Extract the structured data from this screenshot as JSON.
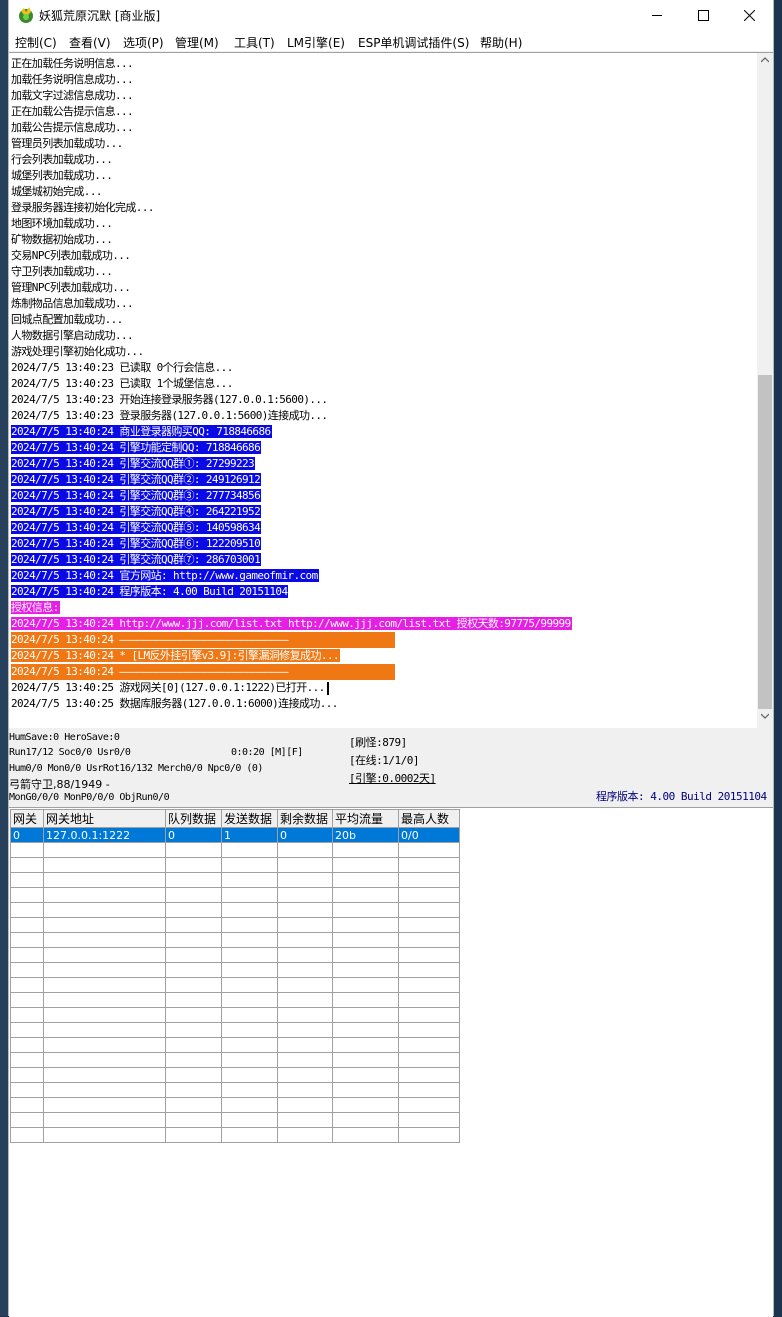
{
  "window": {
    "title": "妖狐荒原沉默 [商业版]"
  },
  "menu": [
    {
      "label": "控制(C)"
    },
    {
      "label": "查看(V)"
    },
    {
      "label": "选项(P)"
    },
    {
      "label": "管理(M)"
    },
    {
      "label": "工具(T)"
    },
    {
      "label": "LM引擎(E)"
    },
    {
      "label": "ESP单机调试插件(S)"
    },
    {
      "label": "帮助(H)"
    }
  ],
  "log": [
    {
      "text": "正在加载任务说明信息...",
      "hl": ""
    },
    {
      "text": "加载任务说明信息成功...",
      "hl": ""
    },
    {
      "text": "加载文字过滤信息成功...",
      "hl": ""
    },
    {
      "text": "正在加载公告提示信息...",
      "hl": ""
    },
    {
      "text": "加载公告提示信息成功...",
      "hl": ""
    },
    {
      "text": "管理员列表加载成功...",
      "hl": ""
    },
    {
      "text": "行会列表加载成功...",
      "hl": ""
    },
    {
      "text": "城堡列表加载成功...",
      "hl": ""
    },
    {
      "text": "城堡城初始完成...",
      "hl": ""
    },
    {
      "text": "登录服务器连接初始化完成...",
      "hl": ""
    },
    {
      "text": "地图环境加载成功...",
      "hl": ""
    },
    {
      "text": "矿物数据初始成功...",
      "hl": ""
    },
    {
      "text": "交易NPC列表加载成功...",
      "hl": ""
    },
    {
      "text": "守卫列表加载成功...",
      "hl": ""
    },
    {
      "text": "管理NPC列表加载成功...",
      "hl": ""
    },
    {
      "text": "炼制物品信息加载成功...",
      "hl": ""
    },
    {
      "text": "回城点配置加载成功...",
      "hl": ""
    },
    {
      "text": "人物数据引擎启动成功...",
      "hl": ""
    },
    {
      "text": "游戏处理引擎初始化成功...",
      "hl": ""
    },
    {
      "text": "2024/7/5 13:40:23 已读取 0个行会信息...",
      "hl": ""
    },
    {
      "text": "2024/7/5 13:40:23 已读取 1个城堡信息...",
      "hl": ""
    },
    {
      "text": "2024/7/5 13:40:23 开始连接登录服务器(127.0.0.1:5600)...",
      "hl": ""
    },
    {
      "text": "2024/7/5 13:40:23 登录服务器(127.0.0.1:5600)连接成功...",
      "hl": ""
    },
    {
      "text": "2024/7/5 13:40:24 商业登录器购买QQ: 718846686",
      "hl": "blue"
    },
    {
      "text": "2024/7/5 13:40:24 引擎功能定制QQ: 718846686",
      "hl": "blue"
    },
    {
      "text": "2024/7/5 13:40:24 引擎交流QQ群①: 27299223",
      "hl": "blue"
    },
    {
      "text": "2024/7/5 13:40:24 引擎交流QQ群②: 249126912",
      "hl": "blue"
    },
    {
      "text": "2024/7/5 13:40:24 引擎交流QQ群③: 277734856",
      "hl": "blue"
    },
    {
      "text": "2024/7/5 13:40:24 引擎交流QQ群④: 264221952",
      "hl": "blue"
    },
    {
      "text": "2024/7/5 13:40:24 引擎交流QQ群⑤: 140598634",
      "hl": "blue"
    },
    {
      "text": "2024/7/5 13:40:24 引擎交流QQ群⑥: 122209510",
      "hl": "blue"
    },
    {
      "text": "2024/7/5 13:40:24 引擎交流QQ群⑦: 286703001",
      "hl": "blue"
    },
    {
      "text": "2024/7/5 13:40:24 官方网站: http://www.gameofmir.com",
      "hl": "blue"
    },
    {
      "text": "2024/7/5 13:40:24 程序版本: 4.00 Build 20151104",
      "hl": "blue"
    },
    {
      "text": "授权信息:",
      "hl": "mag"
    },
    {
      "text": "2024/7/5 13:40:24 http://www.jjj.com/list.txt http://www.jjj.com/list.txt 授权天数:97775/99999",
      "hl": "mag"
    },
    {
      "text": "2024/7/5 13:40:24 ————————————————————————————",
      "hl": "orange"
    },
    {
      "text": "2024/7/5 13:40:24 * [LM反外挂引擎v3.9]:引擎漏洞修复成功...",
      "hl": "orange"
    },
    {
      "text": "2024/7/5 13:40:24 ————————————————————————————",
      "hl": "orange"
    },
    {
      "text": "2024/7/5 13:40:25 游戏网关[0](127.0.0.1:1222)已打开...",
      "hl": "",
      "caret": true
    },
    {
      "text": "2024/7/5 13:40:25 数据库服务器(127.0.0.1:6000)连接成功...",
      "hl": ""
    }
  ],
  "status": {
    "line1": "HumSave:0 HeroSave:0",
    "line2": "Run17/12 Soc0/0 Usr0/0",
    "timer": "0:0:20 [M][F]",
    "line3": "Hum0/0 Mon0/0 UsrRot16/132 Merch0/0 Npc0/0 (0)",
    "line4": "弓箭守卫,88/1949 -",
    "line5": "MonG0/0/0 MonP0/0/0 ObjRun0/0",
    "refresh": "[刷怪:879]",
    "online": "[在线:1/1/0]",
    "engine": "[引擎:0.0002天]",
    "version": "程序版本: 4.00 Build 20151104"
  },
  "gateway_table": {
    "headers": [
      "网关",
      "网关地址",
      "队列数据",
      "发送数据",
      "剩余数据",
      "平均流量",
      "最高人数"
    ],
    "rows": [
      [
        "0",
        "127.0.0.1:1222",
        "0",
        "1",
        "0",
        "20b",
        "0/0"
      ]
    ],
    "empty_rows": 20
  }
}
